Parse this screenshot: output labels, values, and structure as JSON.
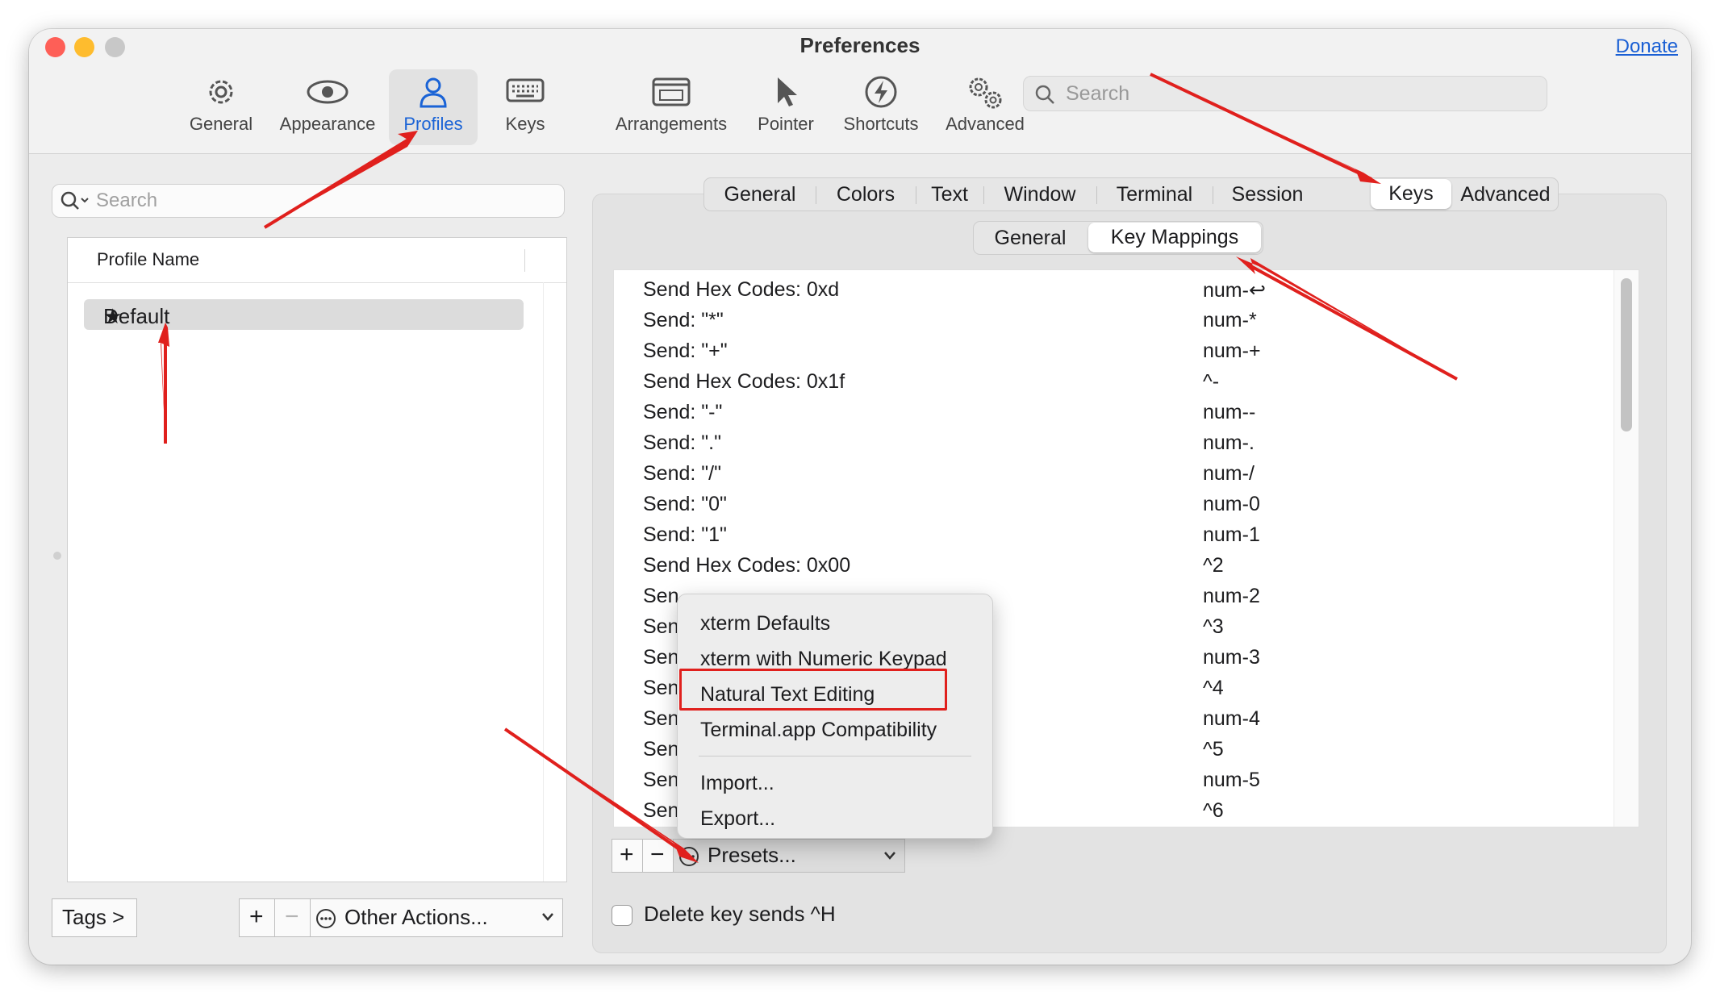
{
  "window": {
    "title": "Preferences",
    "donate_label": "Donate",
    "colors": {
      "close": "#fe5f57",
      "minimize": "#febc2e",
      "zoom": "#c8c8c8",
      "accent": "#1a63d6",
      "annotation": "#e0201d"
    }
  },
  "toolbar": {
    "items": [
      {
        "label": "General",
        "icon": "gear-icon"
      },
      {
        "label": "Appearance",
        "icon": "eye-icon"
      },
      {
        "label": "Profiles",
        "icon": "person-icon",
        "selected": true
      },
      {
        "label": "Keys",
        "icon": "keyboard-icon"
      },
      {
        "label": "Arrangements",
        "icon": "windows-icon"
      },
      {
        "label": "Pointer",
        "icon": "pointer-icon"
      },
      {
        "label": "Shortcuts",
        "icon": "bolt-icon"
      },
      {
        "label": "Advanced",
        "icon": "gears-icon"
      }
    ],
    "search_placeholder": "Search"
  },
  "profiles": {
    "search_placeholder": "Search",
    "column_header": "Profile Name",
    "rows": [
      {
        "star": "★",
        "name": "Default"
      }
    ],
    "tags_label": "Tags >",
    "add_label": "+",
    "remove_label": "−",
    "other_actions_label": "Other Actions...",
    "other_actions_icon": "ellipsis-circle-icon"
  },
  "tabs": [
    "General",
    "Colors",
    "Text",
    "Window",
    "Terminal",
    "Session",
    "Keys",
    "Advanced"
  ],
  "selected_tab": "Keys",
  "subtabs": [
    "General",
    "Key Mappings"
  ],
  "selected_subtab": "Key Mappings",
  "key_mappings": [
    {
      "action": "Send Hex Codes: 0xd",
      "key": "num-↩"
    },
    {
      "action": "Send: \"*\"",
      "key": "num-*"
    },
    {
      "action": "Send: \"+\"",
      "key": "num-+"
    },
    {
      "action": "Send Hex Codes: 0x1f",
      "key": "^-"
    },
    {
      "action": "Send: \"-\"",
      "key": "num--"
    },
    {
      "action": "Send: \".\"",
      "key": "num-."
    },
    {
      "action": "Send: \"/\"",
      "key": "num-/"
    },
    {
      "action": "Send: \"0\"",
      "key": "num-0"
    },
    {
      "action": "Send: \"1\"",
      "key": "num-1"
    },
    {
      "action": "Send Hex Codes: 0x00",
      "key": "^2"
    },
    {
      "action": "Sen",
      "key": "num-2"
    },
    {
      "action": "Sen",
      "key": "^3"
    },
    {
      "action": "Sen",
      "key": "num-3"
    },
    {
      "action": "Sen",
      "key": "^4"
    },
    {
      "action": "Sen",
      "key": "num-4"
    },
    {
      "action": "Sen",
      "key": "^5"
    },
    {
      "action": "Sen",
      "key": "num-5"
    },
    {
      "action": "Sen",
      "key": "^6"
    }
  ],
  "presets_menu": {
    "items": [
      "xterm Defaults",
      "xterm with Numeric Keypad",
      "Natural Text Editing",
      "Terminal.app Compatibility"
    ],
    "file_items": [
      "Import...",
      "Export..."
    ],
    "highlighted": "Natural Text Editing"
  },
  "bottom_bar": {
    "add_label": "+",
    "remove_label": "−",
    "presets_label": "Presets...",
    "presets_icon": "ellipsis-circle-icon"
  },
  "delete_key_option": {
    "label": "Delete key sends ^H",
    "checked": false
  }
}
